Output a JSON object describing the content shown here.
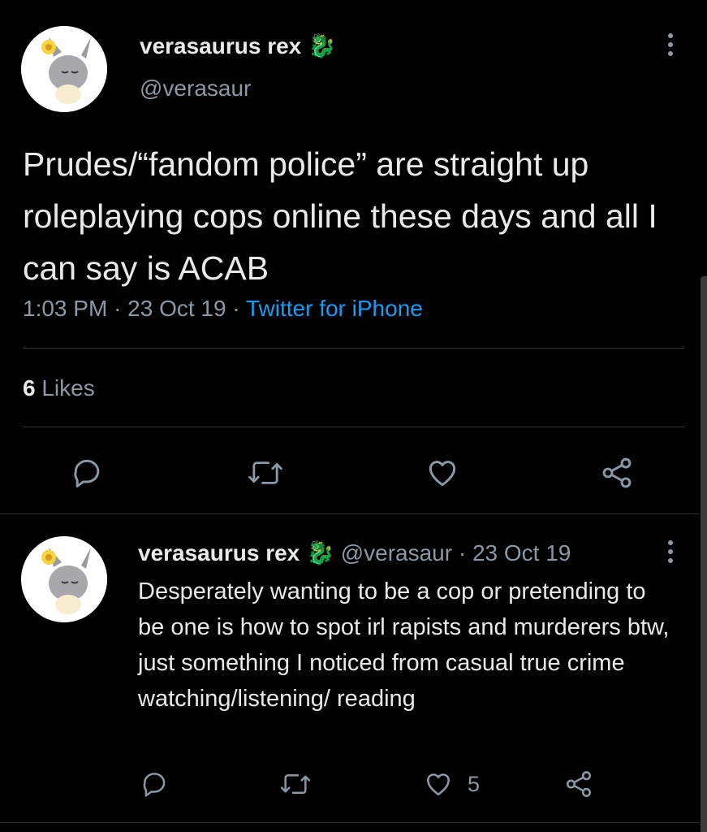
{
  "main_tweet": {
    "author_name": "verasaurus rex",
    "author_emoji": "🐉",
    "handle": "@verasaur",
    "text": "Prudes/“fandom police” are straight up roleplaying cops online these days and all I can say is ACAB",
    "time": "1:03 PM",
    "date": "23 Oct 19",
    "source": "Twitter for iPhone",
    "likes_count": "6",
    "likes_label": "Likes"
  },
  "reply_tweet": {
    "author_name": "verasaurus rex",
    "author_emoji": "🐉",
    "handle": "@verasaur",
    "date": "23 Oct 19",
    "text": "Desperately wanting to be a cop or pretending to be one is how to spot irl rapists and murderers btw, just something I noticed from casual true crime watching/listening/ reading",
    "like_count": "5"
  },
  "colors": {
    "background": "#000000",
    "text": "#e7e9ea",
    "muted": "#8b98a5",
    "link": "#1d9bf0",
    "divider": "#2f3336"
  },
  "icons": [
    "reply-icon",
    "retweet-icon",
    "like-icon",
    "share-icon",
    "more-icon"
  ]
}
